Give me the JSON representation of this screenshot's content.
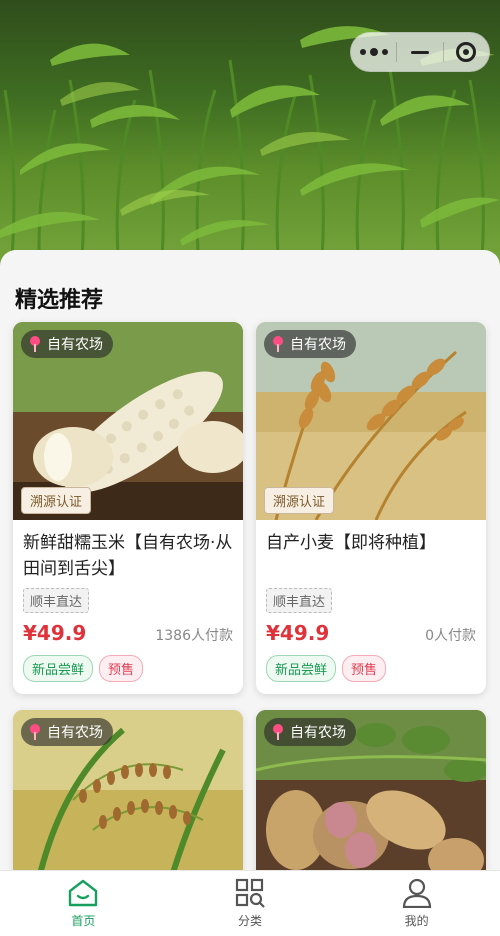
{
  "capsule": {
    "more_icon": "more-dots-icon",
    "minimize_icon": "minimize-icon",
    "close_icon": "target-close-icon"
  },
  "section": {
    "title": "精选推荐"
  },
  "products": [
    {
      "farm_tag": "自有农场",
      "trace": "溯源认证",
      "title": "新鲜甜糯玉米【自有农场·从田间到舌尖】",
      "shipping": "顺丰直达",
      "price": "¥49.9",
      "sales": "1386人付款",
      "badges": [
        "新品尝鲜",
        "预售"
      ]
    },
    {
      "farm_tag": "自有农场",
      "trace": "溯源认证",
      "title": "自产小麦【即将种植】",
      "shipping": "顺丰直达",
      "price": "¥49.9",
      "sales": "0人付款",
      "badges": [
        "新品尝鲜",
        "预售"
      ]
    },
    {
      "farm_tag": "自有农场"
    },
    {
      "farm_tag": "自有农场"
    }
  ],
  "tabbar": [
    {
      "label": "首页",
      "icon": "home-icon",
      "active": true
    },
    {
      "label": "分类",
      "icon": "category-icon",
      "active": false
    },
    {
      "label": "我的",
      "icon": "profile-icon",
      "active": false
    }
  ],
  "colors": {
    "accent": "#17a05d",
    "price": "#e0323a"
  }
}
